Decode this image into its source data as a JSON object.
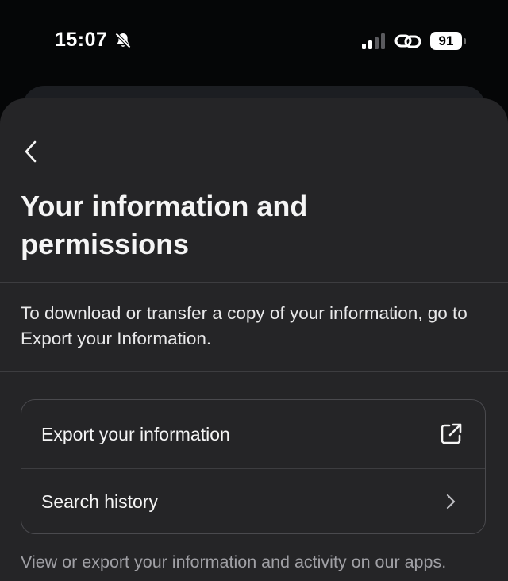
{
  "status_bar": {
    "time": "15:07",
    "battery_level": "91",
    "icons": [
      "bell-off-icon",
      "signal-icon",
      "link-icon",
      "battery-icon"
    ]
  },
  "header": {
    "back_icon": "chevron-left-icon",
    "title": "Your information and permissions"
  },
  "description": "To download or transfer a copy of your information, go to Export your Information.",
  "options": [
    {
      "label": "Export your information",
      "icon": "external-link-icon"
    },
    {
      "label": "Search history",
      "icon": "chevron-right-icon"
    }
  ],
  "footnote": "View or export your information and activity on our apps."
}
